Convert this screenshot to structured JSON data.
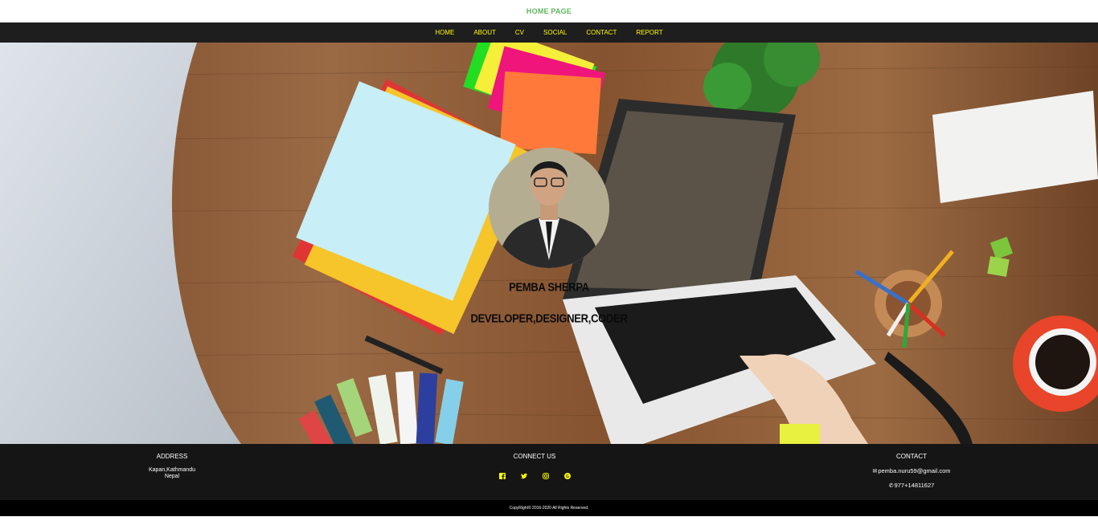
{
  "header": {
    "title": "HOME PAGE"
  },
  "nav": {
    "items": [
      {
        "label": "HOME"
      },
      {
        "label": "ABOUT"
      },
      {
        "label": "CV"
      },
      {
        "label": "SOCIAL"
      },
      {
        "label": "CONTACT"
      },
      {
        "label": "REPORT"
      }
    ]
  },
  "hero": {
    "name": "PEMBA SHERPA",
    "role": "DEVELOPER,DESIGNER,CODER"
  },
  "footer": {
    "address": {
      "heading": "ADDRESS",
      "line1": "Kapan,Kathmandu",
      "line2": "Nepal"
    },
    "connect": {
      "heading": "CONNECT US",
      "icons": [
        "facebook-icon",
        "twitter-icon",
        "instagram-icon",
        "google-plus-icon"
      ]
    },
    "contact": {
      "heading": "CONTACT",
      "email": "pemba.nuru59@gmail.com",
      "phone": "977+14811627"
    },
    "copyright": "CopyRight© 2016-2020 All Rights Reserved."
  },
  "colors": {
    "accent": "#ffff00",
    "title_green": "#5cb85c",
    "nav_bg": "#1e1e1e",
    "footer_bg": "#151515"
  }
}
